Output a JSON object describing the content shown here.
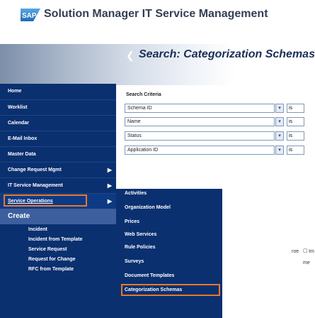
{
  "header": {
    "logo_text": "SAP",
    "title": "Solution Manager IT Service Management"
  },
  "page": {
    "title": "Search: Categorization Schemas"
  },
  "sidebar": {
    "items": [
      {
        "label": "Home"
      },
      {
        "label": "Worklist"
      },
      {
        "label": "Calendar"
      },
      {
        "label": "E-Mail Inbox"
      },
      {
        "label": "Master Data"
      },
      {
        "label": "Change Request Mgmt"
      },
      {
        "label": "IT Service Management"
      },
      {
        "label": "Service Operations"
      }
    ],
    "create_label": "Create",
    "create_items": [
      {
        "label": "Incident"
      },
      {
        "label": "Incident from Template"
      },
      {
        "label": "Service Request"
      },
      {
        "label": "Request for Change"
      },
      {
        "label": "RFC from Template"
      }
    ]
  },
  "search": {
    "criteria_label": "Search Criteria",
    "rows": [
      {
        "field": "Schema ID",
        "operator": "is"
      },
      {
        "field": "Name",
        "operator": "is"
      },
      {
        "field": "Status",
        "operator": "is"
      },
      {
        "field": "Application ID",
        "operator": "is"
      }
    ]
  },
  "flyout": {
    "items": [
      {
        "label": "Activities"
      },
      {
        "label": "Organization Model"
      },
      {
        "label": "Prices"
      },
      {
        "label": "Web Services"
      },
      {
        "label": "Rule Policies"
      },
      {
        "label": "Surveys"
      },
      {
        "label": "Document Templates"
      },
      {
        "label": "Categorization Schemas"
      }
    ]
  },
  "right_fragments": {
    "roe": "roe",
    "im": "Im",
    "me": "me"
  },
  "colors": {
    "sidebar": "#0a3070",
    "highlight": "#e8782a",
    "title": "#1b2f55"
  }
}
